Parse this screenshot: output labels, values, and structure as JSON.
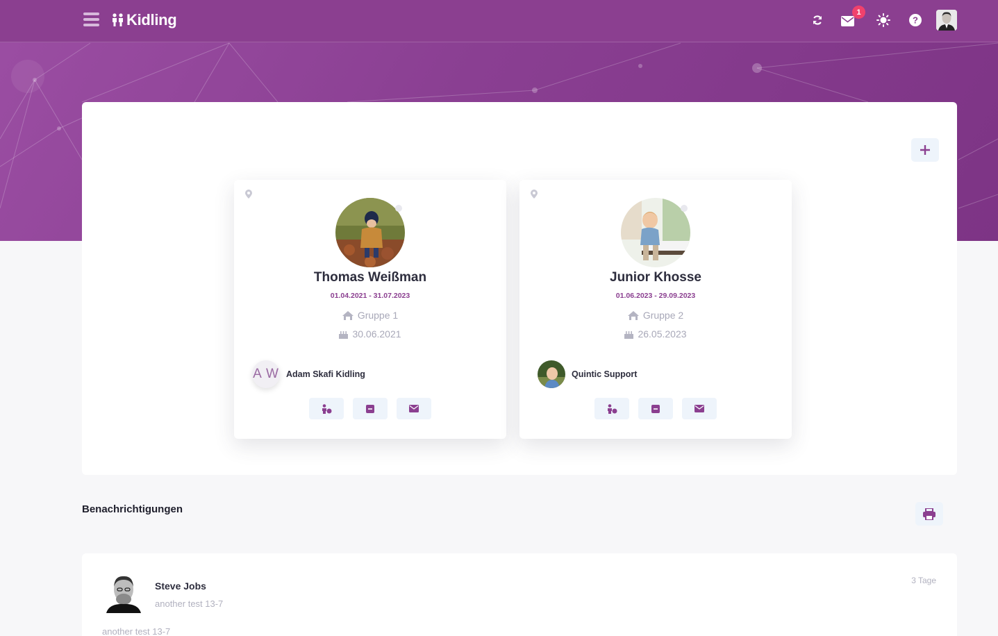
{
  "app": {
    "brand": "Kidling",
    "colors": {
      "primary": "#8b3f90",
      "accent_badge": "#f0416c",
      "button_bg": "#eef4fb"
    }
  },
  "topbar": {
    "menu_icon": "hamburger-icon",
    "icons": [
      "refresh-icon",
      "mail-icon",
      "sun-icon",
      "help-icon"
    ],
    "mail_badge": "1"
  },
  "children": [
    {
      "name": "Thomas Weißman",
      "dates": "01.04.2021 - 31.07.2023",
      "group": "Gruppe 1",
      "birthday": "30.06.2021",
      "guardian_initials": "A W",
      "guardian_name": "Adam Skafi Kidling"
    },
    {
      "name": "Junior Khosse",
      "dates": "01.06.2023 - 29.09.2023",
      "group": "Gruppe 2",
      "birthday": "26.05.2023",
      "guardian_initials": "",
      "guardian_name": "Quintic Support"
    }
  ],
  "notifications": {
    "title": "Benachrichtigungen",
    "items": [
      {
        "sender": "Steve Jobs",
        "subject": "another test 13-7",
        "time": "3 Tage",
        "body": "another test 13-7"
      }
    ]
  }
}
